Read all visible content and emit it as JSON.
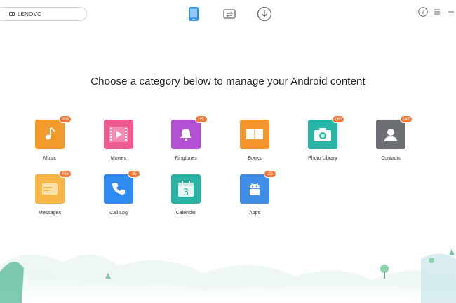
{
  "device": {
    "name": "LENOVO",
    "icon": "device-icon"
  },
  "nav": [
    {
      "id": "phone",
      "icon": "phone-icon",
      "active": true,
      "color": "#2b8ff0"
    },
    {
      "id": "transfer",
      "icon": "transfer-icon",
      "active": false,
      "color": "#666666"
    },
    {
      "id": "download",
      "icon": "download-icon",
      "active": false,
      "color": "#666666"
    }
  ],
  "controls": {
    "help": "help-icon",
    "menu": "menu-icon",
    "minimize": "minimize-icon"
  },
  "heading": "Choose a category below to manage your Android content",
  "categories": [
    {
      "label": "Music",
      "count": "306",
      "icon": "music-icon",
      "color": "#f39a2c"
    },
    {
      "label": "Movies",
      "count": "",
      "icon": "movie-icon",
      "color": "#ee5b93"
    },
    {
      "label": "Ringtones",
      "count": "15",
      "icon": "bell-icon",
      "color": "#b350d4"
    },
    {
      "label": "Books",
      "count": "",
      "icon": "book-icon",
      "color": "#f4952d"
    },
    {
      "label": "Photo Library",
      "count": "160",
      "icon": "camera-icon",
      "color": "#27b5a8"
    },
    {
      "label": "Contacts",
      "count": "147",
      "icon": "contact-icon",
      "color": "#6c6f73"
    },
    {
      "label": "Messages",
      "count": "765",
      "icon": "message-icon",
      "color": "#f7b548"
    },
    {
      "label": "Call Log",
      "count": "35",
      "icon": "phone-call-icon",
      "color": "#2e8bf2"
    },
    {
      "label": "Calendar",
      "count": "",
      "icon": "calendar-icon",
      "color": "#2ab3a3",
      "day": "3"
    },
    {
      "label": "Apps",
      "count": "22",
      "icon": "android-icon",
      "color": "#3f8fe8"
    }
  ]
}
